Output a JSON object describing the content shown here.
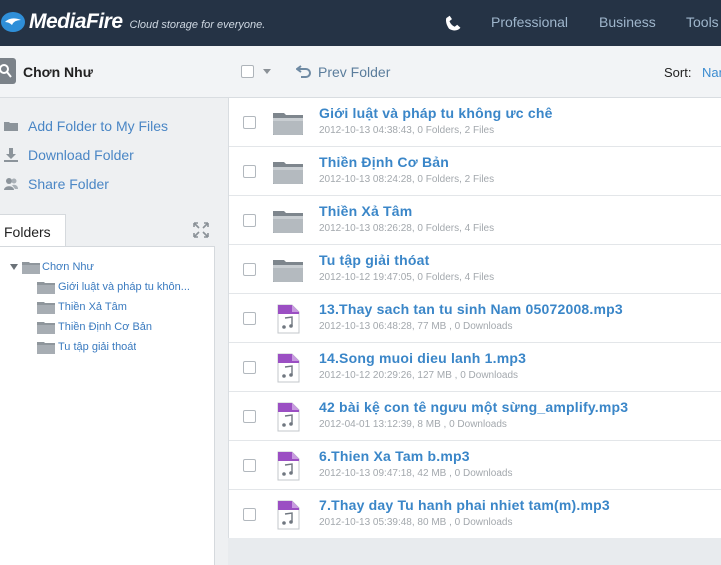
{
  "header": {
    "brand": "MediaFire",
    "tagline": "Cloud storage for everyone.",
    "nav": [
      "Professional",
      "Business",
      "Tools"
    ],
    "colors": {
      "background": "#253345",
      "nav": "#9fb6cc"
    }
  },
  "toolbar": {
    "folder_name": "Chơn Như",
    "prev_folder": "Prev Folder",
    "sort_label": "Sort:",
    "sort_value": "Name"
  },
  "sidebar": {
    "actions": [
      {
        "label": "Add Folder to My Files",
        "icon": "add-folder-icon"
      },
      {
        "label": "Download Folder",
        "icon": "download-icon"
      },
      {
        "label": "Share Folder",
        "icon": "share-users-icon"
      }
    ],
    "folders_tab": "Folders",
    "tree": {
      "root": "Chơn Như",
      "children": [
        "Giới luật và pháp tu khôn...",
        "Thiền Xả Tâm",
        "Thiền Định Cơ Bản",
        "Tu tập giải thoát"
      ]
    }
  },
  "files": [
    {
      "type": "folder",
      "name": "Giới luật và pháp tu không ưc chê",
      "meta": "2012-10-13 04:38:43, 0 Folders, 2 Files"
    },
    {
      "type": "folder",
      "name": "Thiền Định Cơ Bản",
      "meta": "2012-10-13 08:24:28, 0 Folders, 2 Files"
    },
    {
      "type": "folder",
      "name": "Thiền Xả Tâm",
      "meta": "2012-10-13 08:26:28, 0 Folders, 4 Files"
    },
    {
      "type": "folder",
      "name": "Tu tập giải thóat",
      "meta": "2012-10-12 19:47:05, 0 Folders, 4 Files"
    },
    {
      "type": "audio",
      "name": "13.Thay sach tan tu sinh Nam 05072008.mp3",
      "meta": "2012-10-13 06:48:28, 77 MB , 0 Downloads"
    },
    {
      "type": "audio",
      "name": "14.Song muoi dieu lanh 1.mp3",
      "meta": "2012-10-12 20:29:26, 127 MB , 0 Downloads"
    },
    {
      "type": "audio",
      "name": "42 bài kệ con tê ngưu một sừng_amplify.mp3",
      "meta": "2012-04-01 13:12:39, 8 MB , 0 Downloads"
    },
    {
      "type": "audio",
      "name": "6.Thien Xa Tam b.mp3",
      "meta": "2012-10-13 09:47:18, 42 MB , 0 Downloads"
    },
    {
      "type": "audio",
      "name": "7.Thay day Tu hanh phai nhiet tam(m).mp3",
      "meta": "2012-10-13 05:39:48, 80 MB , 0 Downloads"
    }
  ]
}
